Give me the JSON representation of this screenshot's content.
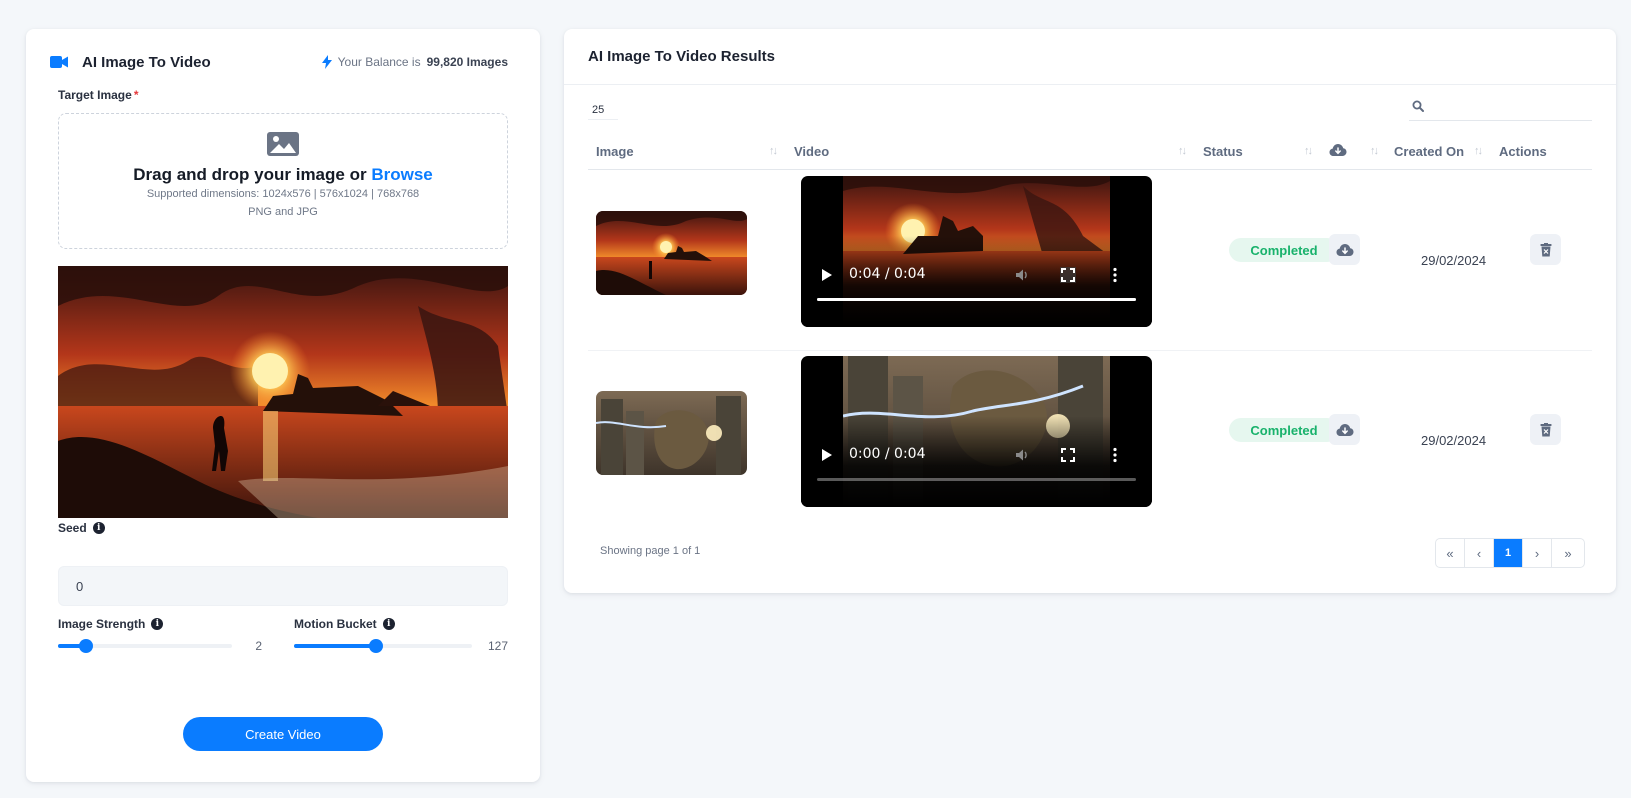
{
  "left_panel": {
    "title": "AI Image To Video",
    "balance_prefix": "Your Balance is",
    "balance_value": "99,820 Images",
    "target_label": "Target Image",
    "required_mark": "*",
    "dropzone": {
      "text": "Drag and drop your image or",
      "browse": "Browse",
      "dimensions": "Supported dimensions: 1024x576 | 576x1024 | 768x768",
      "formats": "PNG and JPG"
    },
    "seed": {
      "label": "Seed",
      "value": "0"
    },
    "image_strength": {
      "label": "Image Strength",
      "value": "2",
      "fraction": 0.16
    },
    "motion_bucket": {
      "label": "Motion Bucket",
      "value": "127",
      "fraction": 0.46
    },
    "create_button": "Create Video"
  },
  "results": {
    "title": "AI Image To Video Results",
    "page_size": "25",
    "columns": [
      "Image",
      "Video",
      "Status",
      "Created On",
      "Actions"
    ],
    "download_column_icon": "cloud-download-icon",
    "rows": [
      {
        "video_time": "0:04 / 0:04",
        "progress": 1.0,
        "status": "Completed",
        "created_on": "29/02/2024"
      },
      {
        "video_time": "0:00 / 0:04",
        "progress": 0.0,
        "status": "Completed",
        "created_on": "29/02/2024"
      }
    ],
    "footer": "Showing page 1 of 1",
    "pagination": {
      "first": "«",
      "prev": "‹",
      "current": "1",
      "next": "›",
      "last": "»"
    }
  },
  "colors": {
    "accent": "#0a7cff",
    "success_text": "#18b26b",
    "success_bg": "#e6f7ef",
    "page_bg": "#f4f7fa"
  }
}
